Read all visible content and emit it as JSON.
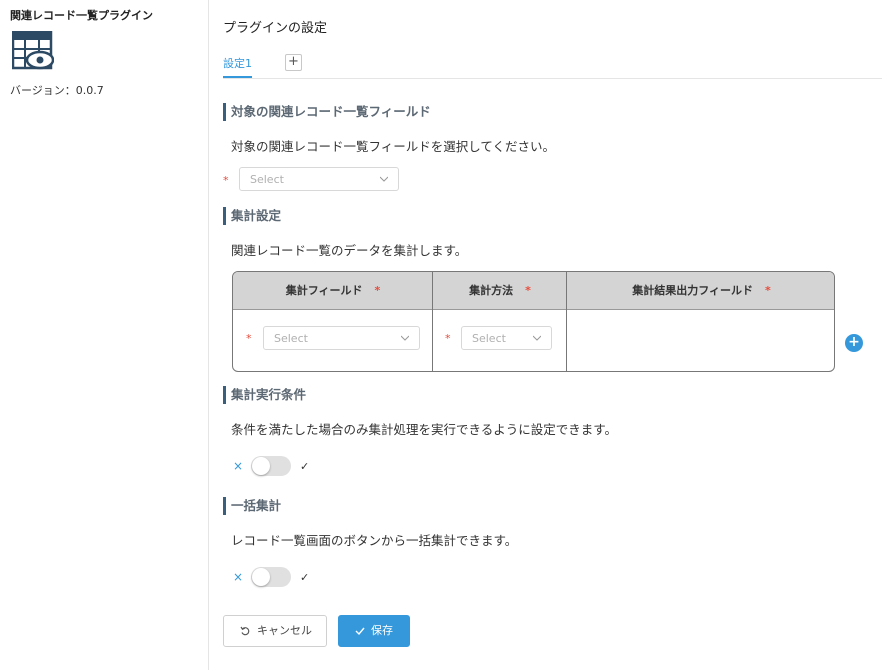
{
  "sidebar": {
    "plugin_name": "関連レコード一覧プラグイン",
    "logo_icon": "table-eye-icon",
    "version": "バージョン：0.0.7"
  },
  "main": {
    "page_title": "プラグインの設定",
    "tabs": [
      {
        "label": "設定1",
        "active": true
      }
    ],
    "add_tab_label": "+"
  },
  "sections": {
    "target": {
      "title": "対象の関連レコード一覧フィールド",
      "description": "対象の関連レコード一覧フィールドを選択してください。",
      "required_mark": "*",
      "select_placeholder": "Select"
    },
    "aggregation": {
      "title": "集計設定",
      "description": "関連レコード一覧のデータを集計します。",
      "columns": [
        {
          "label": "集計フィールド",
          "required_mark": "*"
        },
        {
          "label": "集計方法",
          "required_mark": "*"
        },
        {
          "label": "集計結果出力フィールド",
          "required_mark": "*"
        }
      ],
      "rows": [
        {
          "field_placeholder": "Select",
          "method_placeholder": "Select",
          "required_mark": "*"
        }
      ],
      "add_row_label": "+"
    },
    "condition": {
      "title": "集計実行条件",
      "description": "条件を満たした場合のみ集計処理を実行できるように設定できます。",
      "toggle_off_label": "×",
      "toggle_on_label": "✓",
      "enabled": false
    },
    "bulk": {
      "title": "一括集計",
      "description": "レコード一覧画面のボタンから一括集計できます。",
      "toggle_off_label": "×",
      "toggle_on_label": "✓",
      "enabled": false
    }
  },
  "footer": {
    "cancel_label": "キャンセル",
    "save_label": "保存"
  },
  "colors": {
    "accent": "#3498db",
    "section_bar": "#3a5f7d",
    "required": "#e74c3c",
    "table_header": "#d4d4d4"
  }
}
